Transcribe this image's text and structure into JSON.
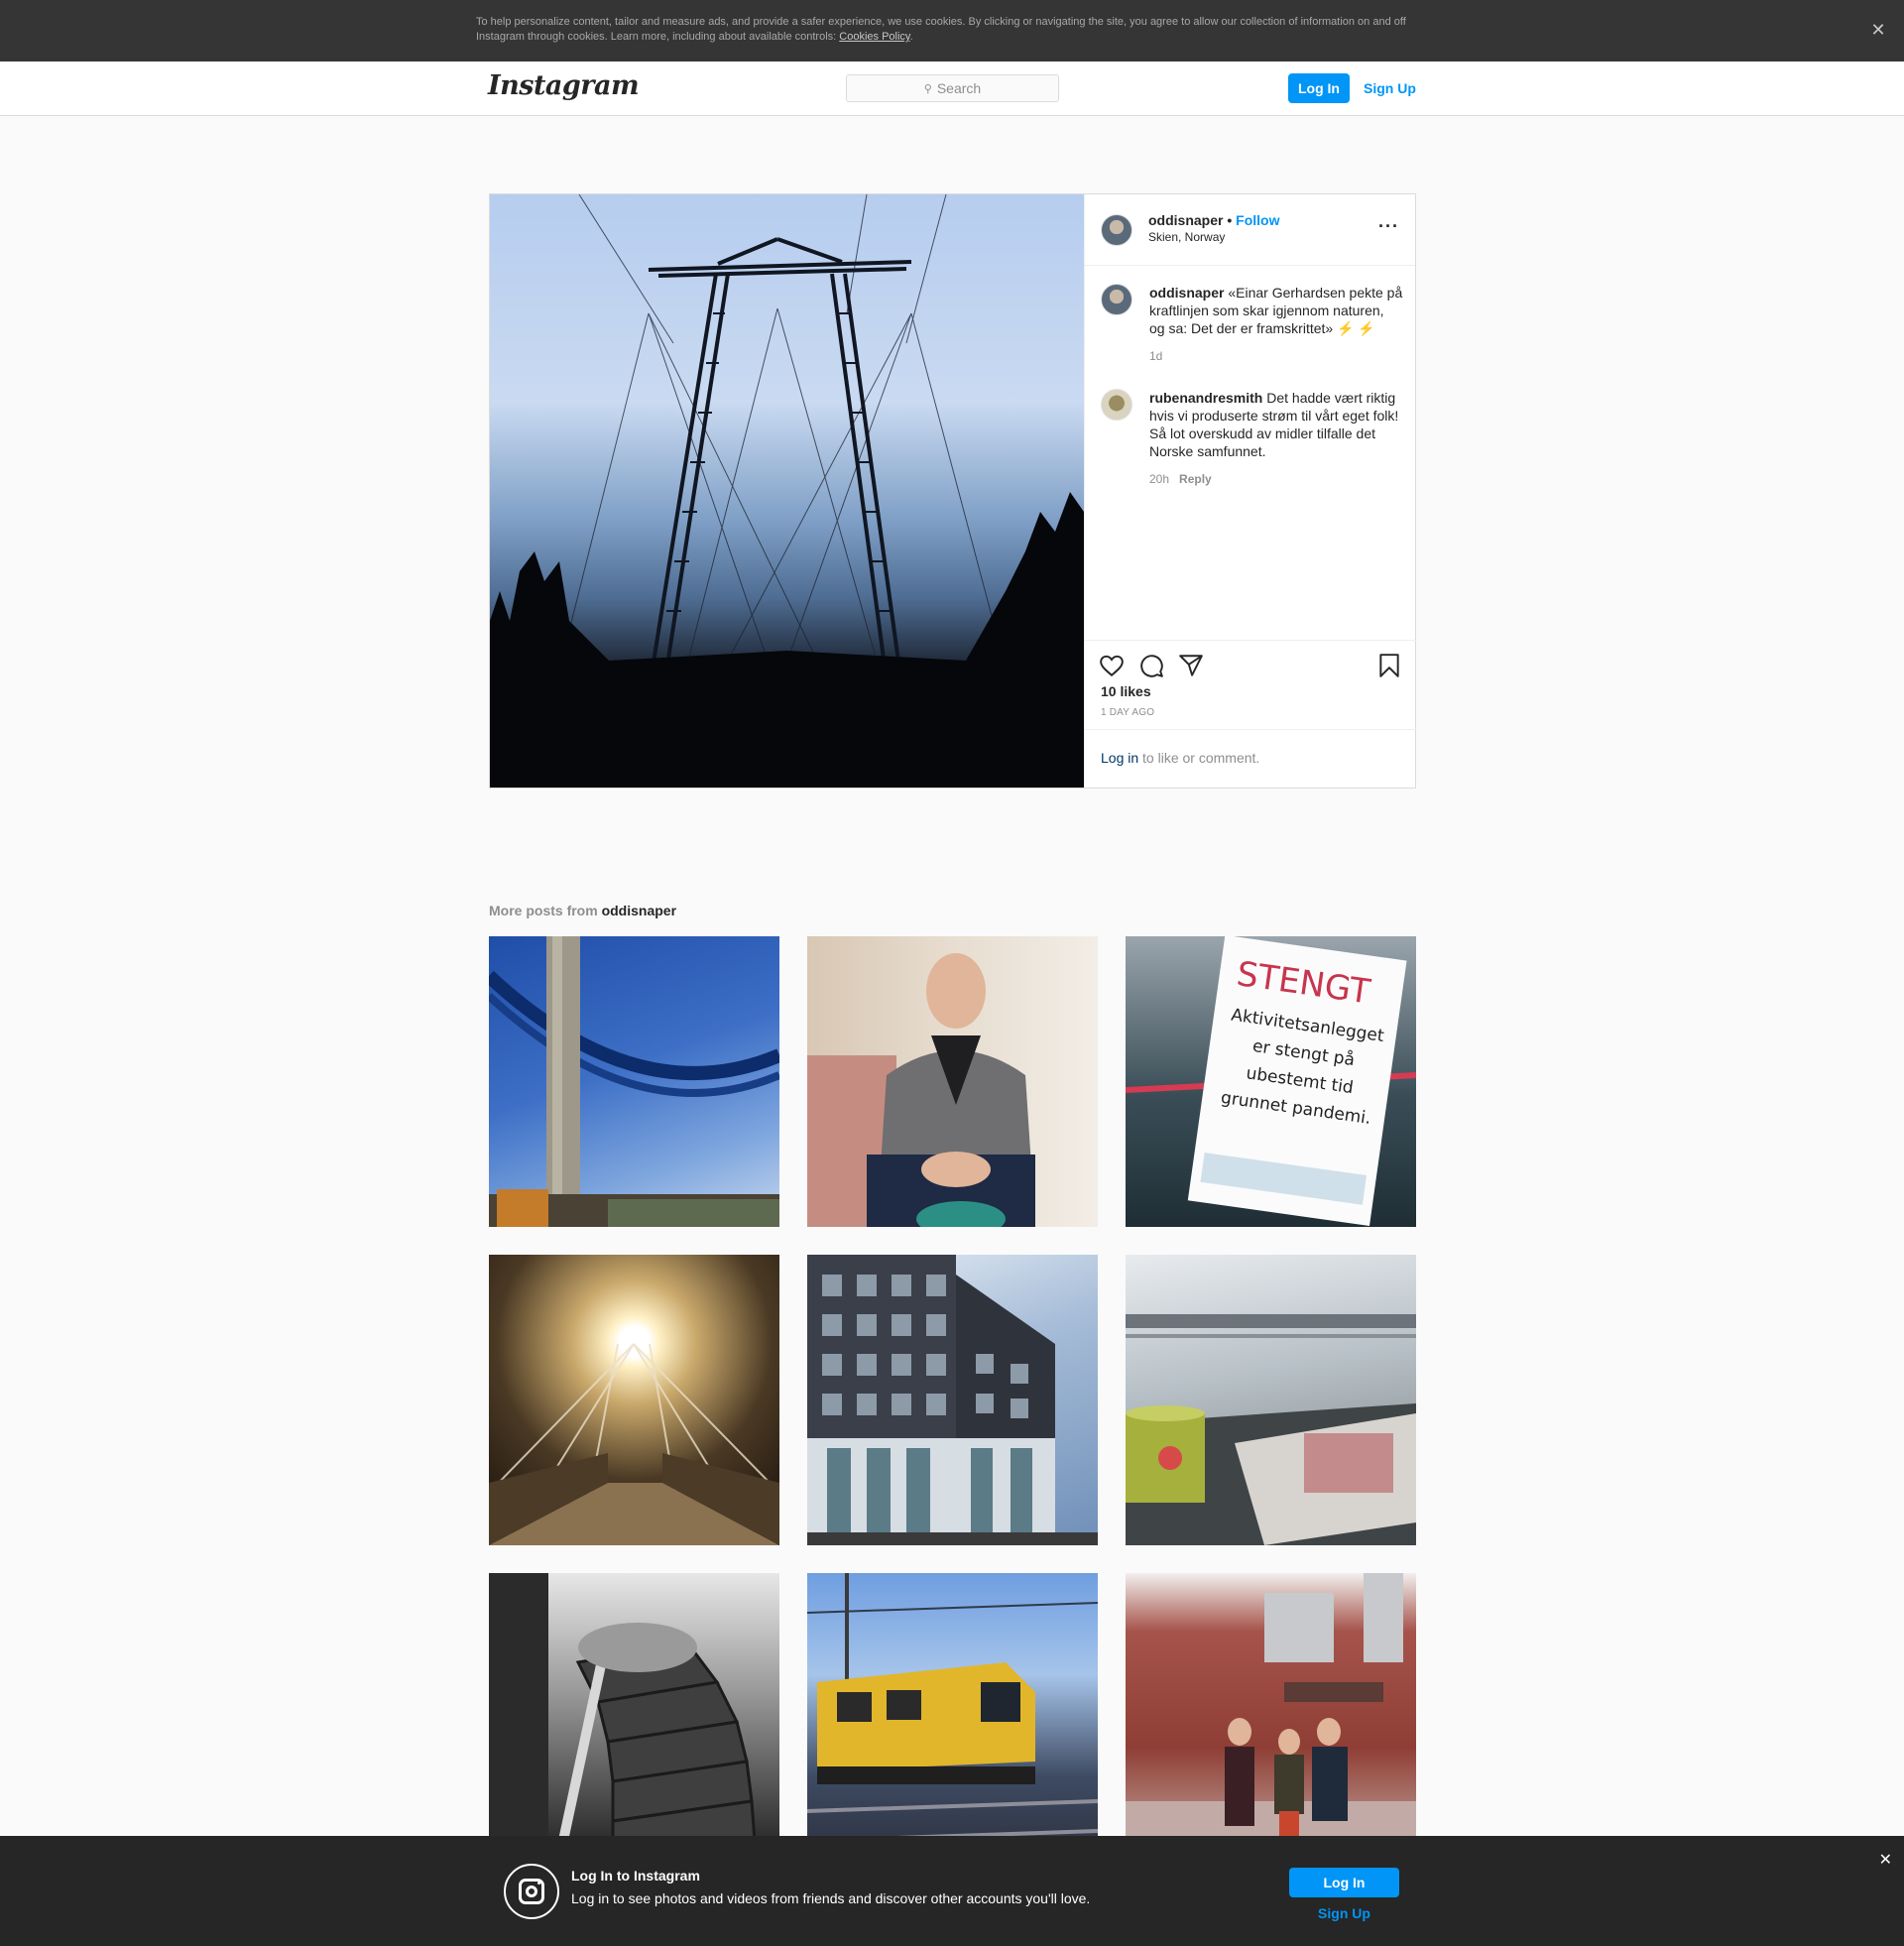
{
  "cookie_banner": {
    "text": "To help personalize content, tailor and measure ads, and provide a safer experience, we use cookies. By clicking or navigating the site, you agree to allow our collection of information on and off Instagram through cookies. Learn more, including about available controls: ",
    "link": "Cookies Policy",
    "end": ".",
    "close": "✕"
  },
  "nav": {
    "logo": "Instagram",
    "search_placeholder": "Search",
    "search_icon": "⚲",
    "login": "Log In",
    "signup": "Sign Up"
  },
  "post": {
    "user": "oddisnaper",
    "dot": "•",
    "follow": "Follow",
    "location": "Skien, Norway",
    "more": "···",
    "caption": {
      "user": "oddisnaper",
      "text": "«Einar Gerhardsen pekte på kraftlinjen som skar igjennom naturen, og sa: Det der er framskrittet» ⚡️ ⚡️",
      "time": "1d"
    },
    "comment": {
      "user": "rubenandresmith",
      "text": "Det hadde vært riktig hvis vi produserte strøm til vårt eget folk! Så lot overskudd av midler tilfalle det Norske samfunnet.",
      "time": "20h",
      "reply": "Reply"
    },
    "likes": "10 likes",
    "time_ago": "1 DAY AGO",
    "login_link": "Log in",
    "login_rest": " to like or comment."
  },
  "more_posts": {
    "prefix": "More posts from ",
    "user": "oddisnaper",
    "tiles": [
      {
        "subject": "suspension bridge under blue sky"
      },
      {
        "subject": "man in grey hoodie seated"
      },
      {
        "subject": "closed sign",
        "sign_title": "STENGT",
        "sign_text": "Aktivitetsanlegget er stengt på ubestemt tid grunnet pandemi."
      },
      {
        "subject": "bridge walkway at night"
      },
      {
        "subject": "modern dark grey building"
      },
      {
        "subject": "coffee mug and newspaper"
      },
      {
        "subject": "spiral staircase"
      },
      {
        "subject": "yellow rail maintenance vehicle"
      },
      {
        "subject": "three people outside brick building"
      }
    ]
  },
  "bottom_bar": {
    "title": "Log In to Instagram",
    "subtitle": "Log in to see photos and videos from friends and discover other accounts you'll love.",
    "login": "Log In",
    "signup": "Sign Up",
    "close": "✕"
  }
}
